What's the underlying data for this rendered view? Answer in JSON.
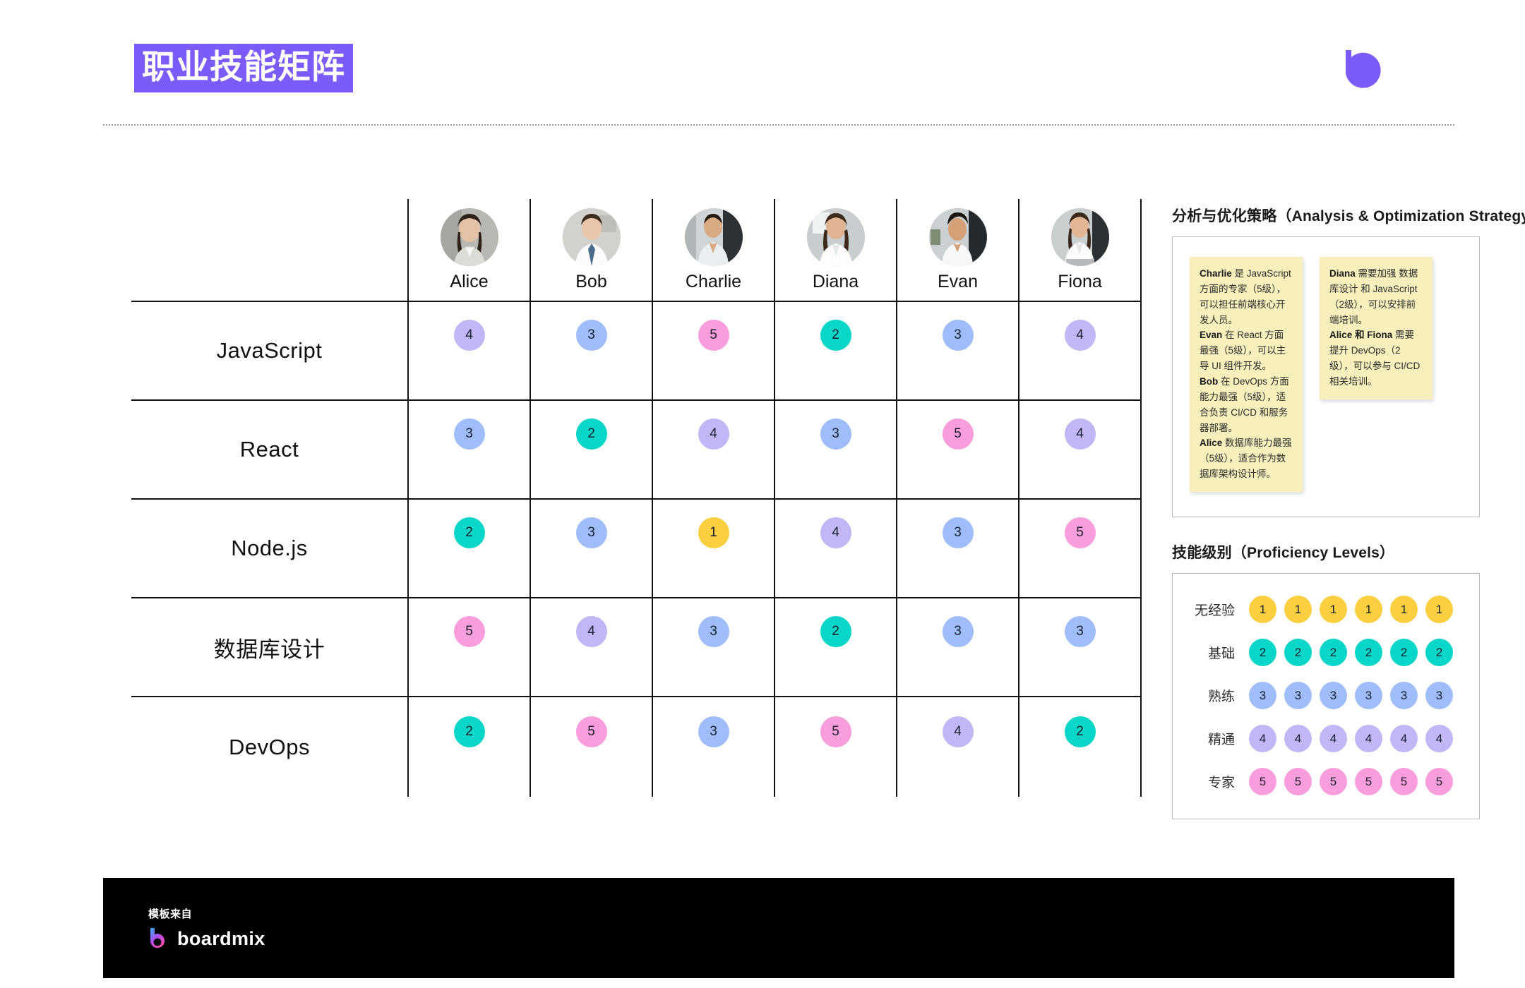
{
  "header": {
    "title": "职业技能矩阵",
    "logo_icon": "boardmix-b-mark-icon"
  },
  "matrix": {
    "skill_column_header": "",
    "people": [
      {
        "name": "Alice",
        "avatar_icon": "avatar-alice"
      },
      {
        "name": "Bob",
        "avatar_icon": "avatar-bob"
      },
      {
        "name": "Charlie",
        "avatar_icon": "avatar-charlie"
      },
      {
        "name": "Diana",
        "avatar_icon": "avatar-diana"
      },
      {
        "name": "Evan",
        "avatar_icon": "avatar-evan"
      },
      {
        "name": "Fiona",
        "avatar_icon": "avatar-fiona"
      }
    ],
    "skills": [
      "JavaScript",
      "React",
      "Node.js",
      "数据库设计",
      "DevOps"
    ],
    "ratings": [
      [
        4,
        3,
        5,
        2,
        3,
        4
      ],
      [
        3,
        2,
        4,
        3,
        5,
        4
      ],
      [
        2,
        3,
        1,
        4,
        3,
        5
      ],
      [
        5,
        4,
        3,
        2,
        3,
        3
      ],
      [
        2,
        5,
        3,
        5,
        4,
        2
      ]
    ]
  },
  "strategy": {
    "heading": "分析与优化策略（Analysis & Optimization Strategy）",
    "notes": [
      {
        "lines": [
          {
            "bold": "Charlie",
            "rest": " 是 JavaScript 方面的专家（5级），可以担任前端核心开发人员。"
          },
          {
            "bold": "Evan",
            "rest": " 在 React 方面最强（5级），可以主导 UI 组件开发。"
          },
          {
            "bold": "Bob",
            "rest": " 在 DevOps 方面能力最强（5级），适合负责 CI/CD 和服务器部署。"
          },
          {
            "bold": "Alice",
            "rest": " 数据库能力最强（5级），适合作为数据库架构设计师。"
          }
        ]
      },
      {
        "lines": [
          {
            "bold": "Diana",
            "rest": " 需要加强 数据库设计 和 JavaScript（2级），可以安排前端培训。"
          },
          {
            "bold": "Alice 和 Fiona",
            "rest": " 需要提升 DevOps（2级），可以参与 CI/CD 相关培训。"
          }
        ]
      }
    ]
  },
  "levels": {
    "heading": "技能级别（Proficiency Levels）",
    "rows": [
      {
        "label": "无经验",
        "value": 1,
        "count": 6,
        "color": "#fbcf3f"
      },
      {
        "label": "基础",
        "value": 2,
        "count": 6,
        "color": "#08d6c8"
      },
      {
        "label": "熟练",
        "value": 3,
        "count": 6,
        "color": "#9fbdfb"
      },
      {
        "label": "精通",
        "value": 4,
        "count": 6,
        "color": "#c2b6f6"
      },
      {
        "label": "专家",
        "value": 5,
        "count": 6,
        "color": "#fa9ddc"
      }
    ]
  },
  "footer": {
    "kicker": "模板来自",
    "wordmark": "boardmix",
    "logo_icon": "boardmix-logo-icon"
  },
  "colors": {
    "title_highlight": "#7b5cfa",
    "level_1": "#fbcf3f",
    "level_2": "#08d6c8",
    "level_3": "#9fbdfb",
    "level_4": "#c2b6f6",
    "level_5": "#fa9ddc",
    "note_bg": "#f7f0bd",
    "footer_bg": "#000000"
  }
}
